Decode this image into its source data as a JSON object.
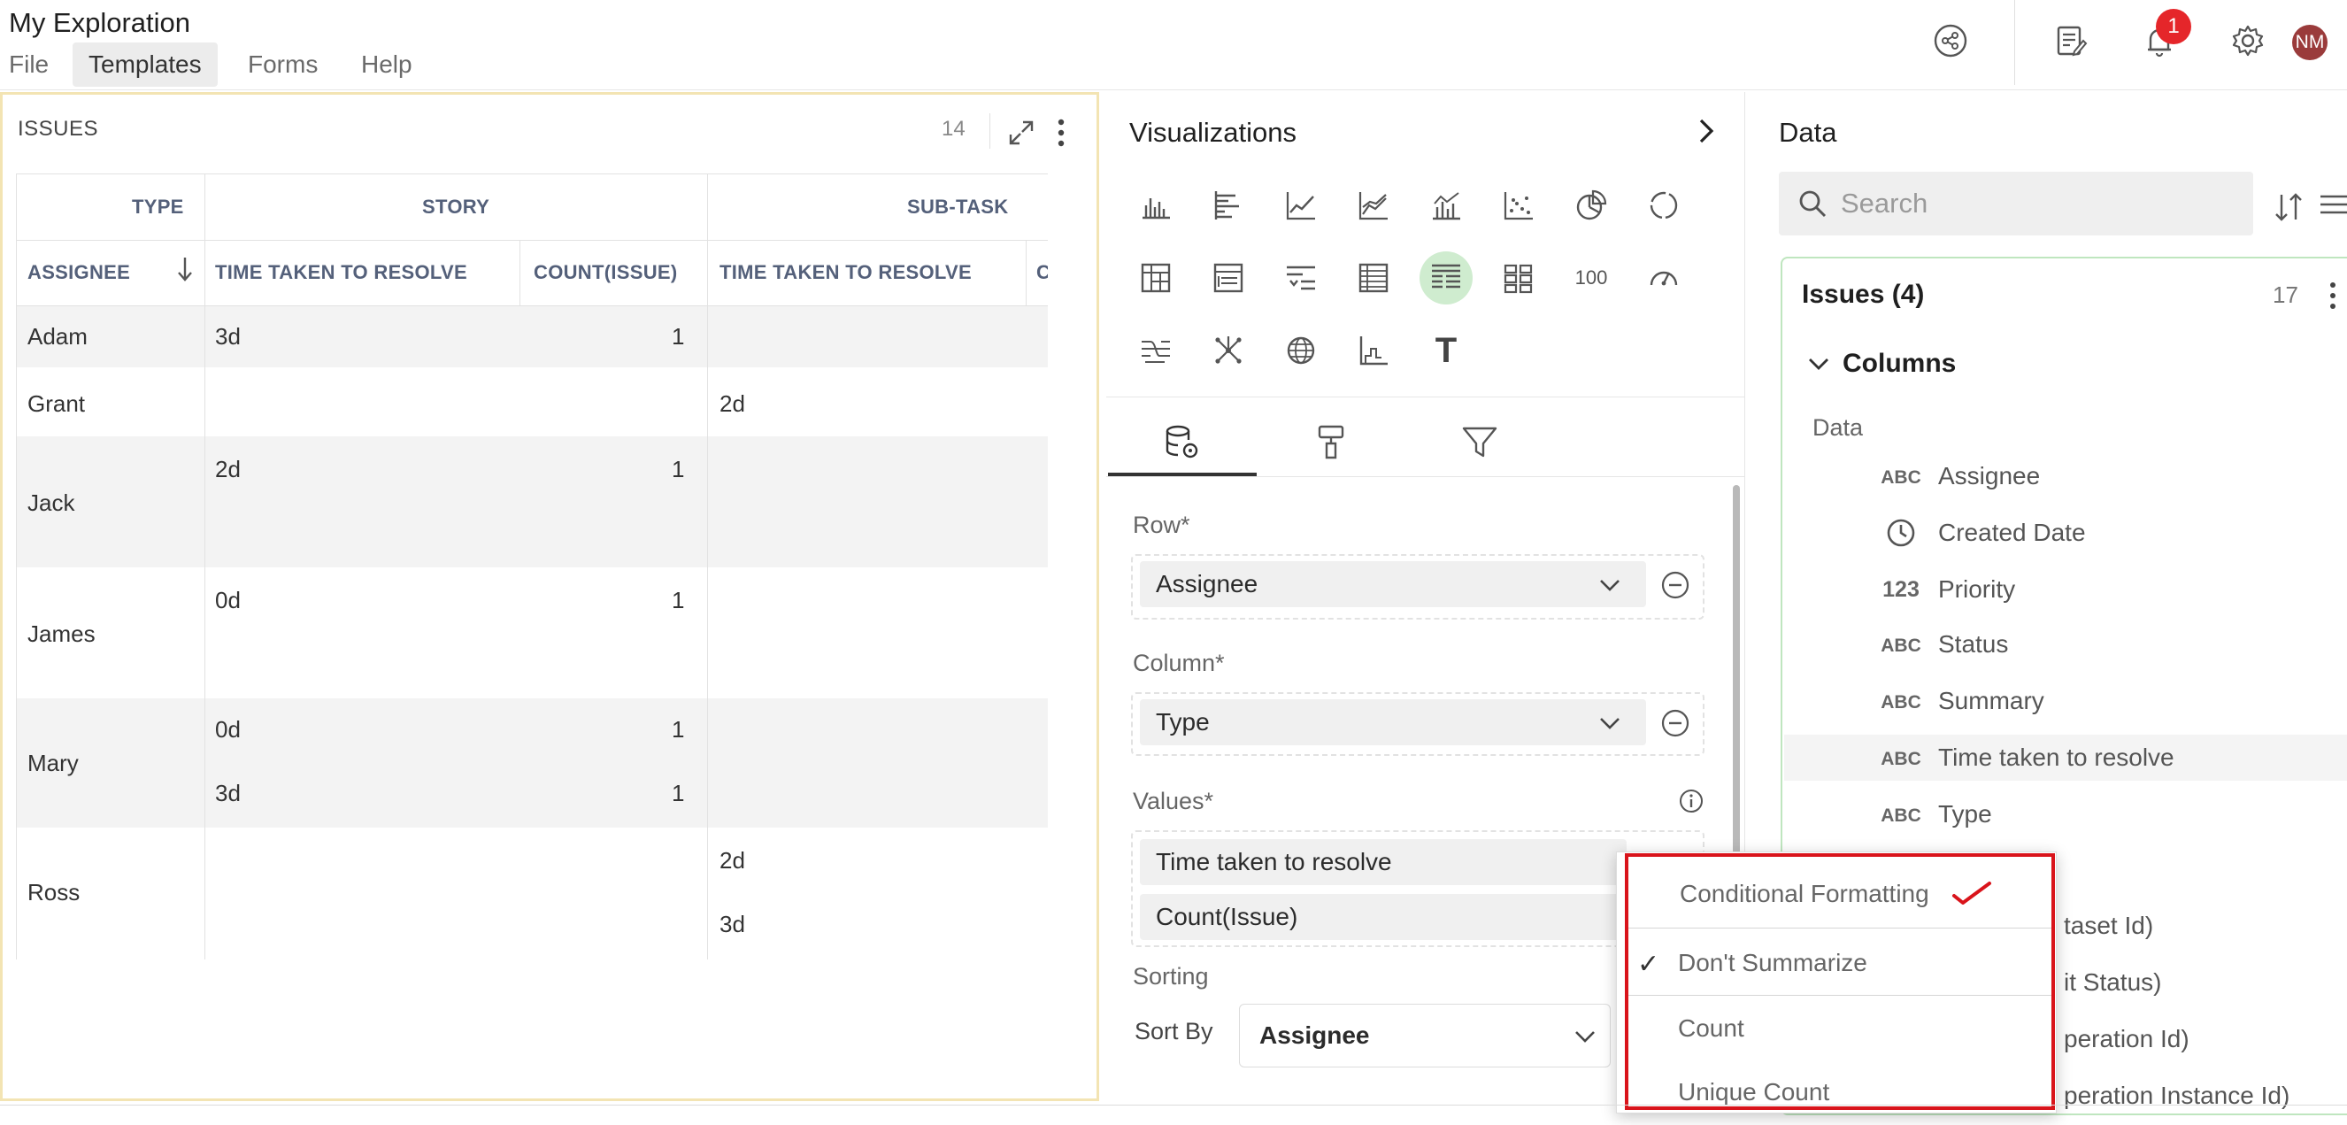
{
  "app": {
    "title": "My Exploration"
  },
  "menu": {
    "file": "File",
    "templates": "Templates",
    "forms": "Forms",
    "help": "Help"
  },
  "header": {
    "notification_count": "1",
    "avatar_initials": "NM"
  },
  "issues_panel": {
    "title": "ISSUES",
    "count": "14",
    "type_header": "TYPE",
    "assignee_header": "ASSIGNEE",
    "story_header": "STORY",
    "subtask_header": "SUB-TASK",
    "time_header": "TIME TAKEN TO RESOLVE",
    "count_header": "COUNT(ISSUE)",
    "time_header_2": "TIME TAKEN TO RESOLVE",
    "count_header_partial": "C",
    "rows": [
      {
        "assignee": "Adam",
        "story_time": [
          "3d"
        ],
        "story_count": [
          "1"
        ],
        "subtask_time": []
      },
      {
        "assignee": "Grant",
        "story_time": [],
        "story_count": [],
        "subtask_time": [
          "2d"
        ]
      },
      {
        "assignee": "Jack",
        "story_time": [
          "2d"
        ],
        "story_count": [
          "1"
        ],
        "subtask_time": []
      },
      {
        "assignee": "James",
        "story_time": [
          "0d"
        ],
        "story_count": [
          "1"
        ],
        "subtask_time": []
      },
      {
        "assignee": "Mary",
        "story_time": [
          "0d",
          "3d"
        ],
        "story_count": [
          "1",
          "1"
        ],
        "subtask_time": []
      },
      {
        "assignee": "Ross",
        "story_time": [],
        "story_count": [],
        "subtask_time": [
          "2d",
          "3d"
        ]
      }
    ]
  },
  "visualizations": {
    "title": "Visualizations",
    "icons": [
      "bar-chart-icon",
      "horizontal-bar-chart-icon",
      "line-chart-icon",
      "area-chart-icon",
      "combo-chart-icon",
      "scatter-plot-icon",
      "pie-chart-icon",
      "donut-chart-icon",
      "pivot-table-icon",
      "table-list-icon",
      "grouped-list-icon",
      "table-icon",
      "pivot-table-icon",
      "tiles-icon",
      "number-icon",
      "gauge-icon",
      "sankey-icon",
      "network-icon",
      "globe-map-icon",
      "histogram-icon",
      "text-icon"
    ],
    "number_icon_text": "100",
    "text_icon_text": "T",
    "active_index": 12,
    "tabs": [
      "data-config-tab",
      "format-tab",
      "filter-tab"
    ]
  },
  "config": {
    "row_label": "Row*",
    "row_value": "Assignee",
    "column_label": "Column*",
    "column_value": "Type",
    "values_label": "Values*",
    "value_1": "Time taken to resolve",
    "value_2": "Count(Issue)",
    "sorting_label": "Sorting",
    "sort_by_label": "Sort By",
    "sort_by_value": "Assignee"
  },
  "data_panel": {
    "title": "Data",
    "search_placeholder": "Search",
    "dataset_title": "Issues (4)",
    "dataset_count": "17",
    "columns_title": "Columns",
    "data_subhead": "Data",
    "columns": [
      {
        "type": "ABC",
        "name": "Assignee"
      },
      {
        "type": "clock",
        "name": "Created Date"
      },
      {
        "type": "123",
        "name": "Priority"
      },
      {
        "type": "ABC",
        "name": "Status"
      },
      {
        "type": "ABC",
        "name": "Summary"
      },
      {
        "type": "ABC",
        "name": "Time taken to resolve"
      },
      {
        "type": "ABC",
        "name": "Type"
      }
    ],
    "hidden_partials": [
      "taset Id)",
      "it Status)",
      "peration Id)",
      "peration Instance Id)"
    ]
  },
  "aggregation_menu": {
    "options": [
      "Conditional Formatting",
      "Don't Summarize",
      "Count",
      "Unique Count"
    ],
    "checked_index": 1,
    "accent_color": "#d9141b"
  }
}
